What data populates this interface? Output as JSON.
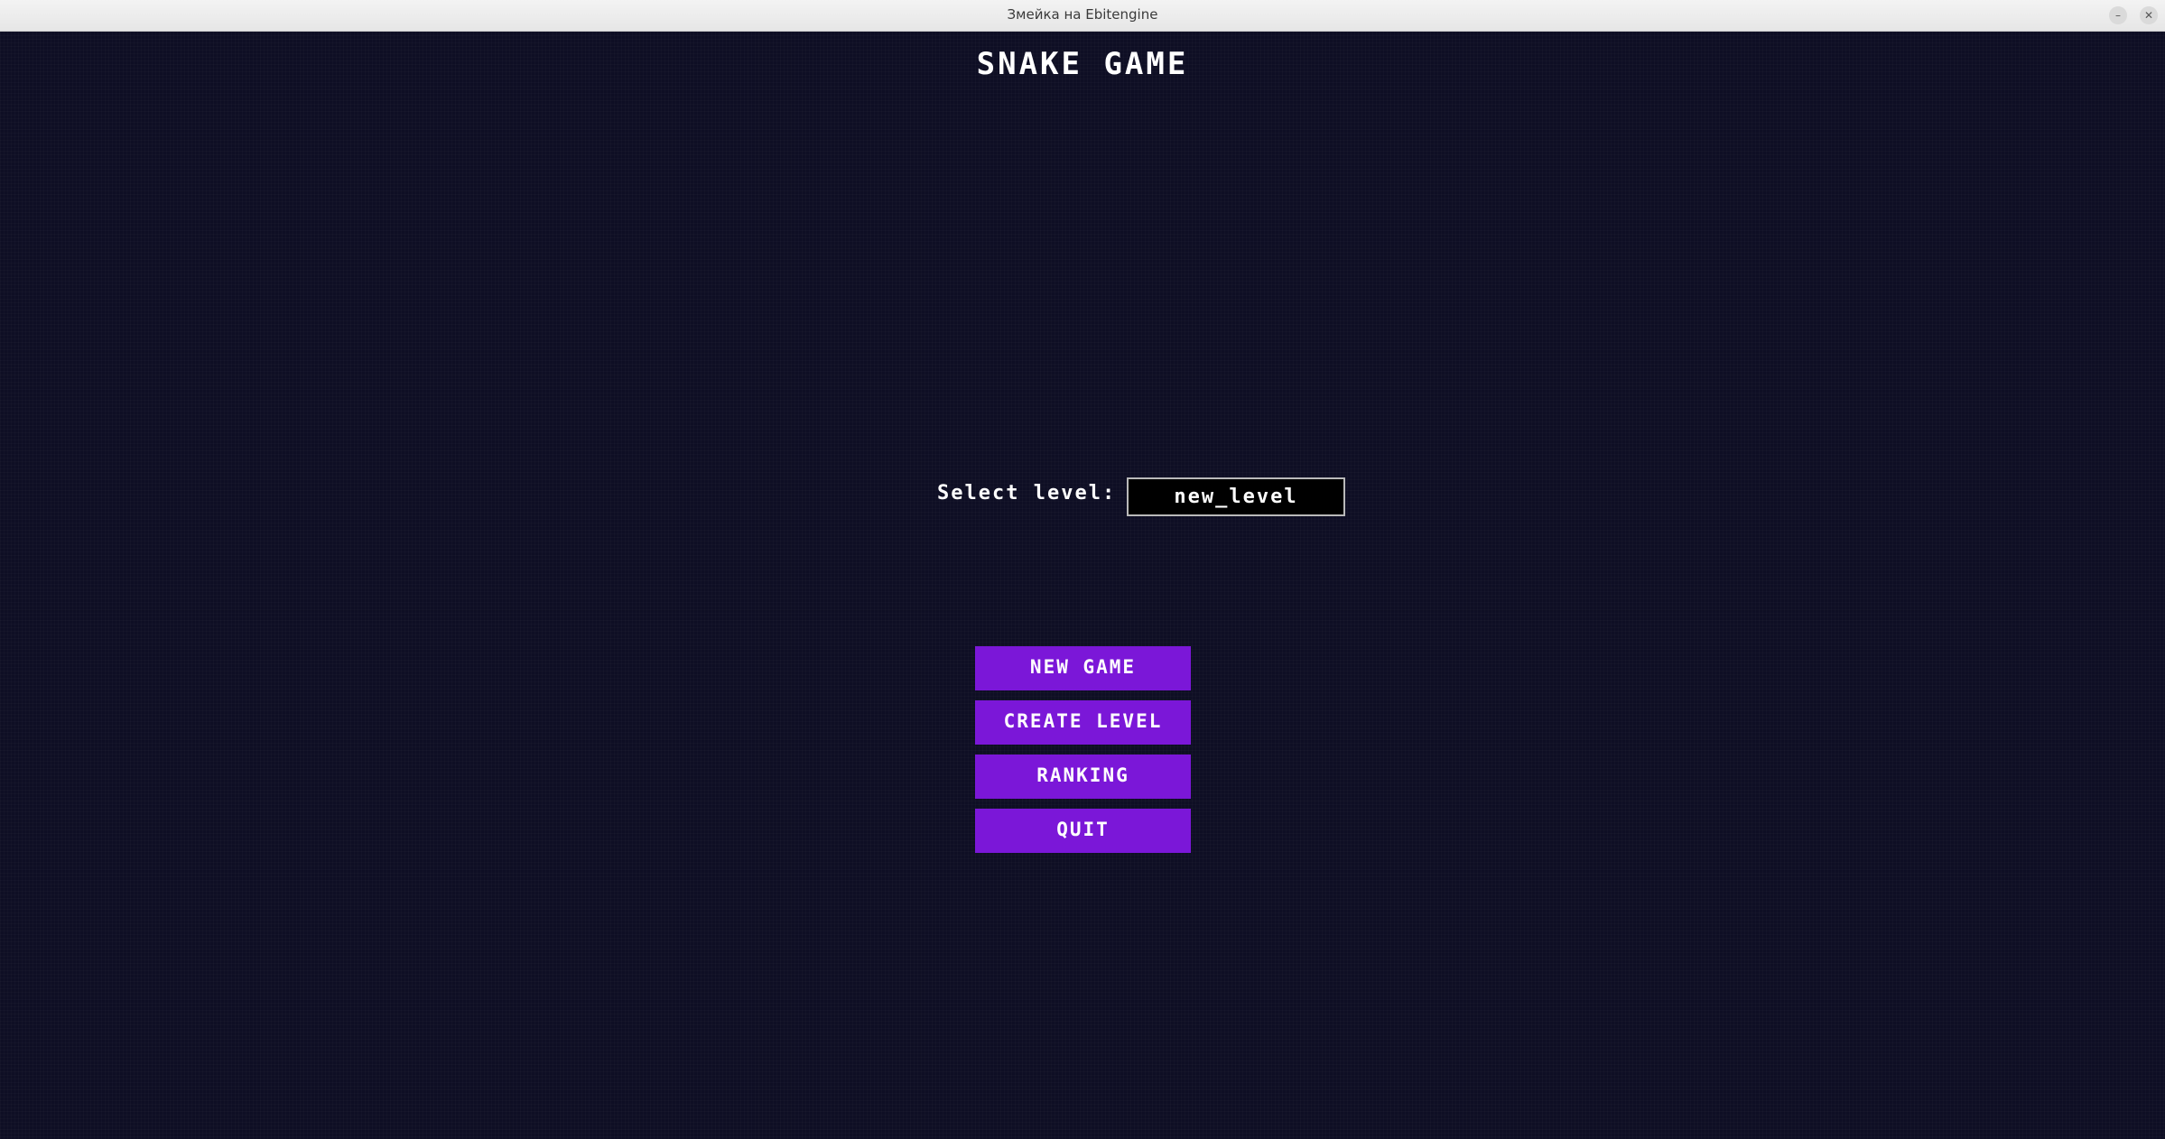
{
  "window": {
    "title": "Змейка на Ebitengine",
    "minimize_glyph": "–",
    "close_glyph": "✕"
  },
  "game": {
    "title": "SNAKE GAME",
    "level_select": {
      "label": "Select level:",
      "value": "new_level"
    },
    "menu": {
      "new_game": "NEW GAME",
      "create_level": "CREATE LEVEL",
      "ranking": "RANKING",
      "quit": "QUIT"
    }
  },
  "colors": {
    "background": "#0e0e24",
    "button": "#7b17d8",
    "text": "#ffffff",
    "input_background": "#000000",
    "input_border": "#b9b9b9"
  }
}
